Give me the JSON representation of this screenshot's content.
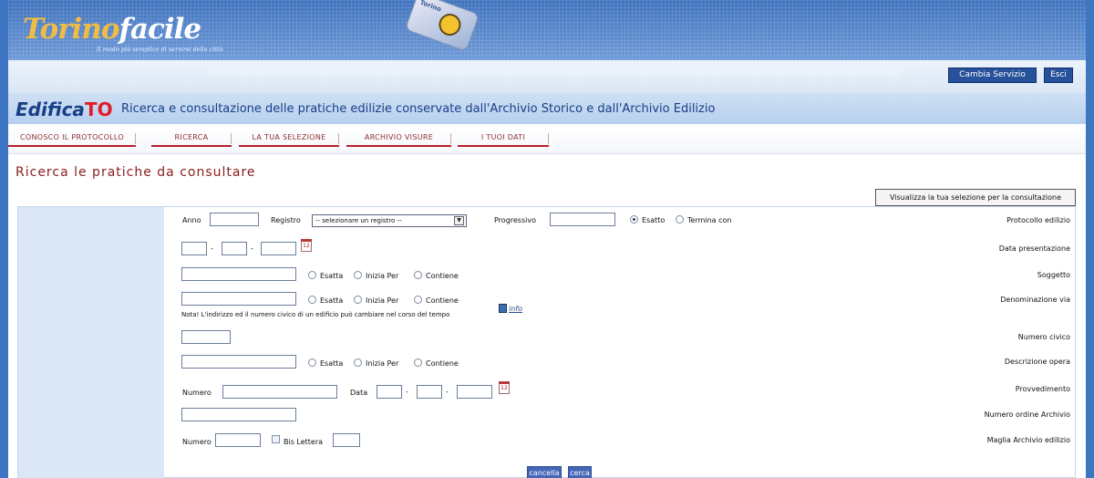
{
  "banner": {
    "logo_part1": "Torino",
    "logo_part2": "facile",
    "tagline": "Il modo più semplice di servirsi della città",
    "card_label": "Torino"
  },
  "topbar": {
    "cambia_servizio": "Cambia Servizio",
    "esci": "Esci"
  },
  "title": {
    "edifica": "Edifica",
    "to": "TO",
    "description": "Ricerca e consultazione delle pratiche edilizie conservate dall'Archivio Storico e dall'Archivio Edilizio"
  },
  "tabs": [
    {
      "label": "CONOSCO IL PROTOCOLLO"
    },
    {
      "label": "RICERCA"
    },
    {
      "label": "LA TUA SELEZIONE"
    },
    {
      "label": "ARCHIVIO VISURE"
    },
    {
      "label": "I TUOI DATI"
    }
  ],
  "section": {
    "title": "Ricerca le pratiche da consultare",
    "view_selection": "Visualizza la tua selezione per la consultazione"
  },
  "form": {
    "rows": [
      {
        "label": "Protocollo edilizio"
      },
      {
        "label": "Data presentazione"
      },
      {
        "label": "Soggetto"
      },
      {
        "label": "Denominazione via"
      },
      {
        "label": "Numero civico"
      },
      {
        "label": "Descrizione opera"
      },
      {
        "label": "Provvedimento"
      },
      {
        "label": "Numero ordine Archivio"
      },
      {
        "label": "Maglia Archivio edilizio"
      }
    ],
    "protocollo": {
      "anno": "Anno",
      "registro": "Registro",
      "registro_selected": "-- selezionare un registro --",
      "progressivo": "Progressivo",
      "esatto": "Esatto",
      "termina": "Termina con"
    },
    "match_options": {
      "esatta": "Esatta",
      "inizia": "Inizia Per",
      "contiene": "Contiene"
    },
    "date_sep": "-",
    "calendar_icon": "12",
    "nota": "Nota! L'indirizzo ed il numero civico di un edificio può cambiare nel corso del tempo",
    "info": "info",
    "provvedimento": {
      "numero": "Numero",
      "data": "Data"
    },
    "maglia": {
      "numero": "Numero",
      "bis_lettera": "Bis Lettera"
    },
    "buttons": {
      "cancella": "cancella",
      "cerca": "cerca"
    }
  }
}
